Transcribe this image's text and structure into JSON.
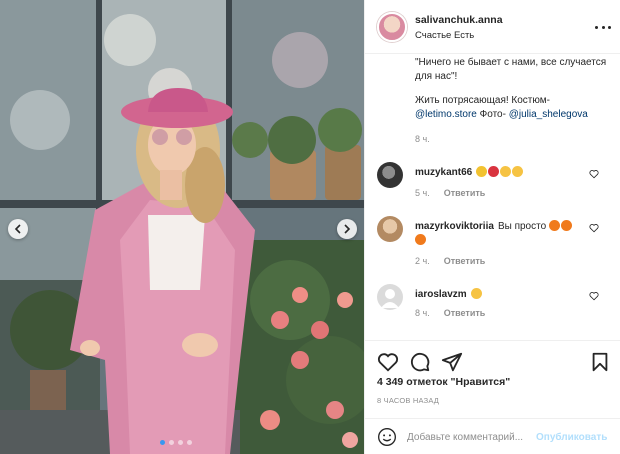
{
  "photo": {
    "alt_icons": [
      "chevron-left-icon",
      "chevron-right-icon"
    ],
    "carousel_dots": 4,
    "carousel_active_index": 0
  },
  "post": {
    "username": "salivanchuk.anna",
    "location": "Счастье Есть",
    "caption_line1": "\"Ничего не бывает с нами, все случается для нас\"!",
    "caption_line2_pre": "Жить потрясающая! Костюм-",
    "caption_link1": "@letimo.store",
    "caption_mid": " Фото- ",
    "caption_link2": "@julia_shelegova",
    "caption_time": "8 ч."
  },
  "comments": [
    {
      "user": "muzykant66",
      "text": "",
      "emoji": [
        "🌻",
        "🌹",
        "😚",
        "😚"
      ],
      "time": "5 ч.",
      "reply": "Ответить"
    },
    {
      "user": "mazyrkoviktoriia",
      "text": "Вы просто",
      "emoji": [
        "🔥",
        "🔥",
        "🔥"
      ],
      "time": "2 ч.",
      "reply": "Ответить"
    },
    {
      "user": "iaroslavzm",
      "text": "",
      "emoji": [
        "😱"
      ],
      "time": "8 ч.",
      "reply": "Ответить"
    }
  ],
  "likes": "4 349 отметок \"Нравится\"",
  "posted": "8 ЧАСОВ НАЗАД",
  "add_comment": {
    "placeholder": "Добавьте комментарий...",
    "publish_label": "Опубликовать"
  },
  "colors": {
    "link": "#00376b",
    "muted": "#8e8e8e",
    "publish_disabled": "#b2dffc",
    "carousel_active": "#3897f0"
  }
}
